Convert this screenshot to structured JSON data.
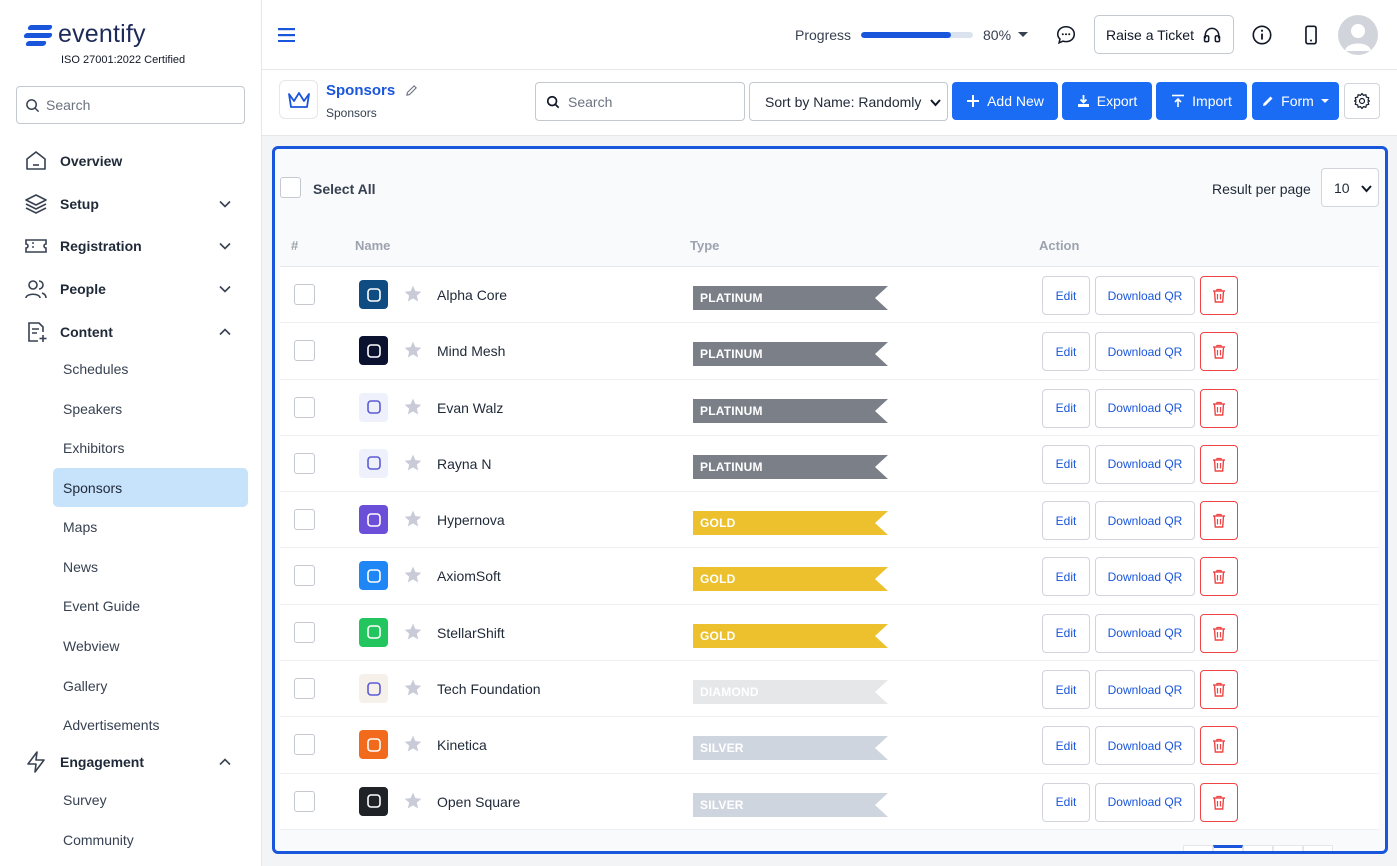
{
  "brand": {
    "name": "eventify",
    "certification": "ISO 27001:2022 Certified"
  },
  "sidebar": {
    "search_placeholder": "Search",
    "items": [
      {
        "label": "Overview",
        "icon": "home-icon"
      },
      {
        "label": "Setup",
        "icon": "layers-icon",
        "expanded": false
      },
      {
        "label": "Registration",
        "icon": "ticket-icon",
        "expanded": false
      },
      {
        "label": "People",
        "icon": "users-icon",
        "expanded": false
      },
      {
        "label": "Content",
        "icon": "document-plus-icon",
        "expanded": true
      },
      {
        "label": "Engagement",
        "icon": "lightning-icon",
        "expanded": true
      }
    ],
    "content_sub": [
      "Schedules",
      "Speakers",
      "Exhibitors",
      "Sponsors",
      "Maps",
      "News",
      "Event Guide",
      "Webview",
      "Gallery",
      "Advertisements"
    ],
    "engagement_sub": [
      "Survey",
      "Community"
    ],
    "active": "Sponsors"
  },
  "topbar": {
    "progress_label": "Progress",
    "progress_value": 0.8,
    "progress_text": "80%",
    "raise_ticket": "Raise a Ticket"
  },
  "header": {
    "title": "Sponsors",
    "breadcrumb": "Sponsors",
    "search_placeholder": "Search",
    "sort_value": "Sort by Name: Randomly",
    "add_new": "Add New",
    "export": "Export",
    "import": "Import",
    "form": "Form"
  },
  "list": {
    "select_all": "Select All",
    "result_per_page_label": "Result per page",
    "result_per_page": "10",
    "columns": [
      "#",
      "Name",
      "Type",
      "Action"
    ],
    "edit_label": "Edit",
    "qr_label": "Download QR",
    "rows": [
      {
        "name": "Alpha Core",
        "type": "PLATINUM",
        "logo_color": "#0f4c81"
      },
      {
        "name": "Mind Mesh",
        "type": "PLATINUM",
        "logo_color": "#0b1230"
      },
      {
        "name": "Evan Walz",
        "type": "PLATINUM",
        "logo_color": "#eef0fb"
      },
      {
        "name": "Rayna N",
        "type": "PLATINUM",
        "logo_color": "#eef0fb"
      },
      {
        "name": "Hypernova",
        "type": "GOLD",
        "logo_color": "#6c4fd8"
      },
      {
        "name": "AxiomSoft",
        "type": "GOLD",
        "logo_color": "#1f86f5"
      },
      {
        "name": "StellarShift",
        "type": "GOLD",
        "logo_color": "#22c55e"
      },
      {
        "name": "Tech Foundation",
        "type": "DIAMOND",
        "logo_color": "#f5f1ea"
      },
      {
        "name": "Kinetica",
        "type": "SILVER",
        "logo_color": "#f26b1d"
      },
      {
        "name": "Open Square",
        "type": "SILVER",
        "logo_color": "#1f2227"
      }
    ]
  },
  "type_colors": {
    "PLATINUM": "#7b8088",
    "GOLD": "#ecc12d",
    "DIAMOND": "#e6e7e9",
    "SILVER": "#cfd5de"
  },
  "accent": "#1a56db"
}
